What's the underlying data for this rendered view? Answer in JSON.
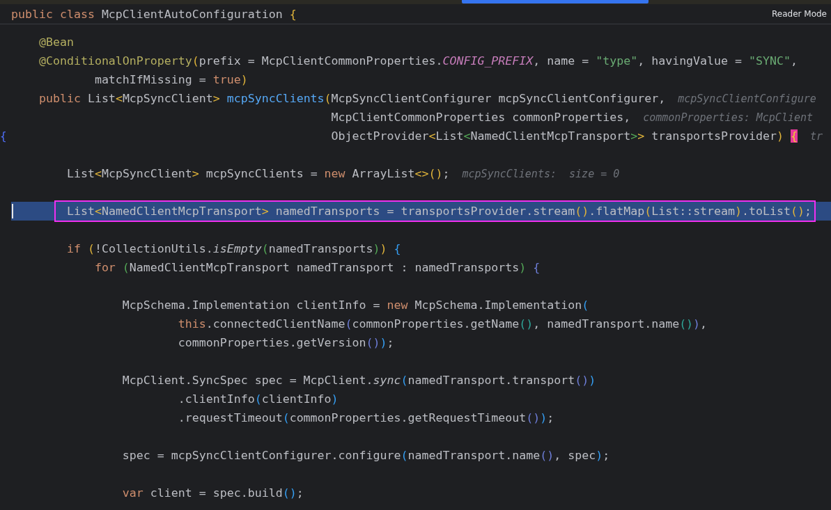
{
  "tab_bar": {
    "active_tab_indicator": true
  },
  "sticky_header": {
    "tokens": [
      {
        "kind": "keyword",
        "text": "public class "
      },
      {
        "kind": "plain",
        "text": "McpClientAutoConfiguration "
      },
      {
        "kind": "b1",
        "text": "{"
      }
    ]
  },
  "reader_mode": "Reader Mode",
  "lines": [
    {
      "kind": "code",
      "tokens": [
        {
          "kind": "annotation",
          "text": "    @Bean"
        }
      ]
    },
    {
      "kind": "code",
      "tokens": [
        {
          "kind": "annotation",
          "text": "    @ConditionalOnProperty"
        },
        {
          "kind": "b1",
          "text": "("
        },
        {
          "kind": "plain",
          "text": "prefix = McpClientCommonProperties."
        },
        {
          "kind": "const",
          "text": "CONFIG_PREFIX"
        },
        {
          "kind": "plain",
          "text": ", name = "
        },
        {
          "kind": "string",
          "text": "\"type\""
        },
        {
          "kind": "plain",
          "text": ", havingValue = "
        },
        {
          "kind": "string",
          "text": "\"SYNC\""
        },
        {
          "kind": "plain",
          "text": ","
        }
      ]
    },
    {
      "kind": "code",
      "tokens": [
        {
          "kind": "plain",
          "text": "            matchIfMissing = "
        },
        {
          "kind": "keyword",
          "text": "true"
        },
        {
          "kind": "b1",
          "text": ")"
        }
      ]
    },
    {
      "kind": "code",
      "tokens": [
        {
          "kind": "keyword",
          "text": "    public "
        },
        {
          "kind": "plain",
          "text": "List"
        },
        {
          "kind": "b1",
          "text": "<"
        },
        {
          "kind": "plain",
          "text": "McpSyncClient"
        },
        {
          "kind": "b1",
          "text": "> "
        },
        {
          "kind": "decl",
          "text": "mcpSyncClients"
        },
        {
          "kind": "b1",
          "text": "("
        },
        {
          "kind": "plain",
          "text": "McpSyncClientConfigurer mcpSyncClientConfigurer,"
        }
      ],
      "hint": "mcpSyncClientConfigure"
    },
    {
      "kind": "code",
      "tokens": [
        {
          "kind": "plain",
          "text": "                                              McpClientCommonProperties commonProperties,"
        }
      ],
      "hint": "commonProperties: McpClient"
    },
    {
      "kind": "code",
      "gutter": "{",
      "tokens": [
        {
          "kind": "plain",
          "text": "                                              ObjectProvider"
        },
        {
          "kind": "b1",
          "text": "<"
        },
        {
          "kind": "plain",
          "text": "List"
        },
        {
          "kind": "b2",
          "text": "<"
        },
        {
          "kind": "plain",
          "text": "NamedClientMcpTransport"
        },
        {
          "kind": "b2",
          "text": ">"
        },
        {
          "kind": "b1",
          "text": ">"
        },
        {
          "kind": "plain",
          "text": " transportsProvider"
        },
        {
          "kind": "b1",
          "text": ") "
        },
        {
          "kind": "match",
          "text": "{"
        }
      ],
      "hint": "tr"
    },
    {
      "kind": "blank"
    },
    {
      "kind": "code",
      "tokens": [
        {
          "kind": "plain",
          "text": "        List"
        },
        {
          "kind": "b1",
          "text": "<"
        },
        {
          "kind": "plain",
          "text": "McpSyncClient"
        },
        {
          "kind": "b1",
          "text": ">"
        },
        {
          "kind": "plain",
          "text": " mcpSyncClients = "
        },
        {
          "kind": "keyword",
          "text": "new"
        },
        {
          "kind": "plain",
          "text": " ArrayList"
        },
        {
          "kind": "b1",
          "text": "<>()"
        },
        {
          "kind": "plain",
          "text": ";"
        }
      ],
      "hint": "mcpSyncClients:  size = 0"
    },
    {
      "kind": "blank"
    },
    {
      "kind": "code",
      "current": true,
      "framed": true,
      "tokens": [
        {
          "kind": "plain",
          "text": "        List"
        },
        {
          "kind": "b1",
          "text": "<"
        },
        {
          "kind": "plain",
          "text": "NamedClientMcpTransport"
        },
        {
          "kind": "b1",
          "text": ">"
        },
        {
          "kind": "plain",
          "text": " namedTransports = transportsProvider.stream"
        },
        {
          "kind": "b1",
          "text": "()"
        },
        {
          "kind": "plain",
          "text": ".flatMap"
        },
        {
          "kind": "b1",
          "text": "("
        },
        {
          "kind": "plain",
          "text": "List::stream"
        },
        {
          "kind": "b1",
          "text": ")"
        },
        {
          "kind": "plain",
          "text": ".toList"
        },
        {
          "kind": "b1",
          "text": "()"
        },
        {
          "kind": "plain",
          "text": ";"
        }
      ]
    },
    {
      "kind": "blank"
    },
    {
      "kind": "code",
      "tokens": [
        {
          "kind": "keyword",
          "text": "        if "
        },
        {
          "kind": "b1",
          "text": "("
        },
        {
          "kind": "plain",
          "text": "!CollectionUtils."
        },
        {
          "kind": "italic",
          "text": "isEmpty"
        },
        {
          "kind": "b2",
          "text": "("
        },
        {
          "kind": "plain",
          "text": "namedTransports"
        },
        {
          "kind": "b2",
          "text": ")"
        },
        {
          "kind": "b1",
          "text": ") "
        },
        {
          "kind": "b3",
          "text": "{"
        }
      ]
    },
    {
      "kind": "code",
      "tokens": [
        {
          "kind": "keyword",
          "text": "            for "
        },
        {
          "kind": "b2",
          "text": "("
        },
        {
          "kind": "plain",
          "text": "NamedClientMcpTransport namedTransport : namedTransports"
        },
        {
          "kind": "b2",
          "text": ") "
        },
        {
          "kind": "b4",
          "text": "{"
        }
      ]
    },
    {
      "kind": "blank"
    },
    {
      "kind": "code",
      "tokens": [
        {
          "kind": "plain",
          "text": "                McpSchema.Implementation clientInfo = "
        },
        {
          "kind": "keyword",
          "text": "new"
        },
        {
          "kind": "plain",
          "text": " McpSchema.Implementation"
        },
        {
          "kind": "b3",
          "text": "("
        }
      ]
    },
    {
      "kind": "code",
      "tokens": [
        {
          "kind": "keyword",
          "text": "                        this"
        },
        {
          "kind": "plain",
          "text": ".connectedClientName"
        },
        {
          "kind": "b4",
          "text": "("
        },
        {
          "kind": "plain",
          "text": "commonProperties.getName"
        },
        {
          "kind": "b5",
          "text": "()"
        },
        {
          "kind": "plain",
          "text": ", namedTransport.name"
        },
        {
          "kind": "b5",
          "text": "()"
        },
        {
          "kind": "b4",
          "text": ")"
        },
        {
          "kind": "plain",
          "text": ","
        }
      ]
    },
    {
      "kind": "code",
      "tokens": [
        {
          "kind": "plain",
          "text": "                        commonProperties.getVersion"
        },
        {
          "kind": "b4",
          "text": "()"
        },
        {
          "kind": "b3",
          "text": ")"
        },
        {
          "kind": "plain",
          "text": ";"
        }
      ]
    },
    {
      "kind": "blank"
    },
    {
      "kind": "code",
      "tokens": [
        {
          "kind": "plain",
          "text": "                McpClient.SyncSpec spec = McpClient."
        },
        {
          "kind": "italic",
          "text": "sync"
        },
        {
          "kind": "b3",
          "text": "("
        },
        {
          "kind": "plain",
          "text": "namedTransport.transport"
        },
        {
          "kind": "b4",
          "text": "()"
        },
        {
          "kind": "b3",
          "text": ")"
        }
      ]
    },
    {
      "kind": "code",
      "tokens": [
        {
          "kind": "plain",
          "text": "                        .clientInfo"
        },
        {
          "kind": "b3",
          "text": "("
        },
        {
          "kind": "plain",
          "text": "clientInfo"
        },
        {
          "kind": "b3",
          "text": ")"
        }
      ]
    },
    {
      "kind": "code",
      "tokens": [
        {
          "kind": "plain",
          "text": "                        .requestTimeout"
        },
        {
          "kind": "b3",
          "text": "("
        },
        {
          "kind": "plain",
          "text": "commonProperties.getRequestTimeout"
        },
        {
          "kind": "b4",
          "text": "()"
        },
        {
          "kind": "b3",
          "text": ")"
        },
        {
          "kind": "plain",
          "text": ";"
        }
      ]
    },
    {
      "kind": "blank"
    },
    {
      "kind": "code",
      "tokens": [
        {
          "kind": "plain",
          "text": "                spec = mcpSyncClientConfigurer.configure"
        },
        {
          "kind": "b3",
          "text": "("
        },
        {
          "kind": "plain",
          "text": "namedTransport.name"
        },
        {
          "kind": "b4",
          "text": "()"
        },
        {
          "kind": "plain",
          "text": ", spec"
        },
        {
          "kind": "b3",
          "text": ")"
        },
        {
          "kind": "plain",
          "text": ";"
        }
      ]
    },
    {
      "kind": "blank"
    },
    {
      "kind": "code",
      "tokens": [
        {
          "kind": "keyword",
          "text": "                var"
        },
        {
          "kind": "plain",
          "text": " client = spec.build"
        },
        {
          "kind": "b3",
          "text": "()"
        },
        {
          "kind": "plain",
          "text": ";"
        }
      ]
    }
  ]
}
